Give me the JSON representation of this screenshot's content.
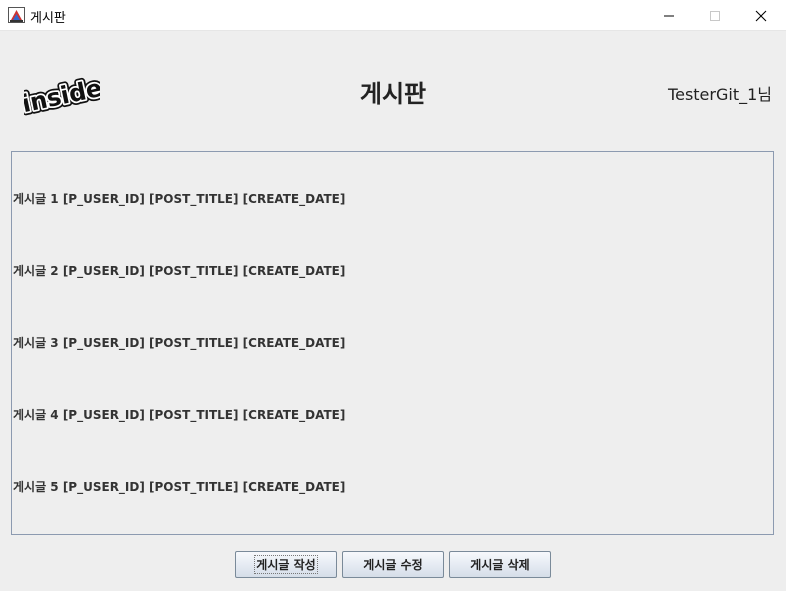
{
  "window": {
    "title": "게시판",
    "controls": [
      "minimize-icon",
      "maximize-icon",
      "close-icon"
    ]
  },
  "header": {
    "logo_text": "inside",
    "title": "게시판",
    "user_label": "TesterGit_1님"
  },
  "posts": [
    {
      "label": "게시글 1 [P_USER_ID] [POST_TITLE] [CREATE_DATE]"
    },
    {
      "label": "게시글 2 [P_USER_ID] [POST_TITLE] [CREATE_DATE]"
    },
    {
      "label": "게시글 3 [P_USER_ID] [POST_TITLE] [CREATE_DATE]"
    },
    {
      "label": "게시글 4 [P_USER_ID] [POST_TITLE] [CREATE_DATE]"
    },
    {
      "label": "게시글 5 [P_USER_ID] [POST_TITLE] [CREATE_DATE]"
    }
  ],
  "buttons": {
    "write": "게시글 작성",
    "edit": "게시글 수정",
    "delete": "게시글 삭제"
  },
  "colors": {
    "background": "#eeeeee",
    "panel_border": "#8c9ab0",
    "button_border": "#7a8a99"
  }
}
